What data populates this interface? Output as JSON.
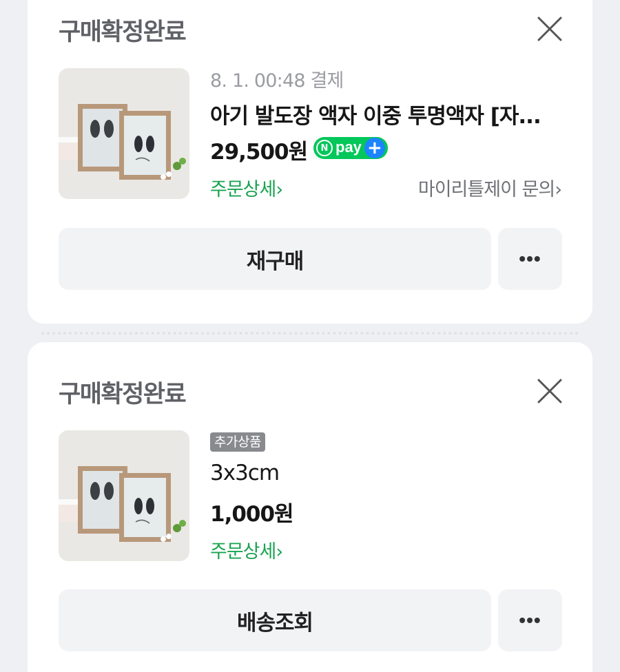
{
  "orders": [
    {
      "status": "구매확정완료",
      "date_text": "8. 1. 00:48 결제",
      "product_name": "아기 발도장 액자 이중 투명액자 [자...",
      "price": "29,500원",
      "payment_badge": {
        "n": "N",
        "label": "pay",
        "plus": "+"
      },
      "detail_link": "주문상세",
      "inquiry_link": "마이리틀제이 문의",
      "primary_button": "재구매",
      "more_button": "•••"
    },
    {
      "status": "구매확정완료",
      "tag": "추가상품",
      "option_name": "3x3cm",
      "price": "1,000원",
      "detail_link": "주문상세",
      "primary_button": "배송조회",
      "more_button": "•••"
    }
  ],
  "icons": {
    "close": "close-icon",
    "chevron": "chevron-right-icon",
    "thumbnail": "product-thumbnail"
  },
  "colors": {
    "accent_green": "#19a350",
    "npay_green": "#03c75a",
    "npay_blue": "#1d84ff",
    "status_gray": "#5f6166"
  }
}
